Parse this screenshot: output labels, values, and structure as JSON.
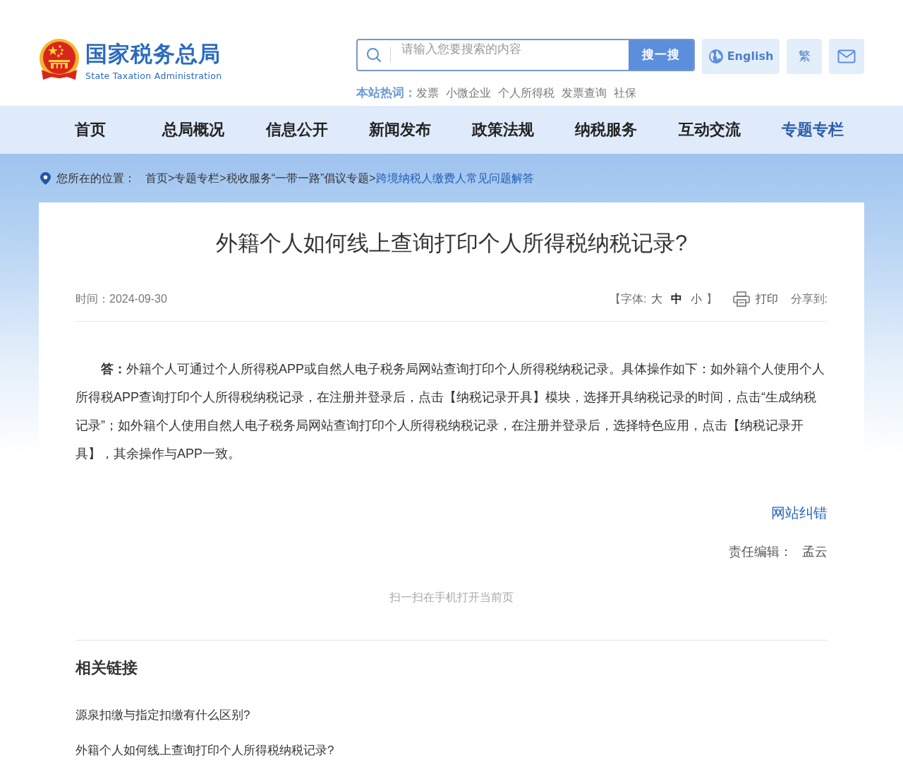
{
  "header": {
    "logo": {
      "title": "国家税务总局",
      "subtitle": "State Taxation Administration"
    },
    "search": {
      "placeholder": "请输入您要搜索的内容",
      "button": "搜一搜"
    },
    "hot_words": {
      "label": "本站热词：",
      "items": [
        "发票",
        "小微企业",
        "个人所得税",
        "发票查询",
        "社保"
      ]
    },
    "language_button": "English",
    "script_button": "繁"
  },
  "nav": [
    {
      "label": "首页",
      "selected": false
    },
    {
      "label": "总局概况",
      "selected": false
    },
    {
      "label": "信息公开",
      "selected": false
    },
    {
      "label": "新闻发布",
      "selected": false
    },
    {
      "label": "政策法规",
      "selected": false
    },
    {
      "label": "纳税服务",
      "selected": false
    },
    {
      "label": "互动交流",
      "selected": false
    },
    {
      "label": "专题专栏",
      "selected": true
    }
  ],
  "breadcrumb": {
    "label": "您所在的位置：",
    "items": [
      {
        "label": "首页",
        "separator": ">",
        "current": false
      },
      {
        "label": "专题专栏",
        "separator": ">",
        "current": false
      },
      {
        "label": "税收服务“一带一路”倡议专题",
        "separator": ">",
        "current": false
      },
      {
        "label": "跨境纳税人缴费人常见问题解答",
        "current": true
      }
    ]
  },
  "article": {
    "title": "外籍个人如何线上查询打印个人所得税纳税记录?",
    "date_label": "时间：",
    "date": "2024-09-30",
    "font_size": {
      "open": "【字体:",
      "options": [
        {
          "label": "大",
          "selected": false
        },
        {
          "label": "中",
          "selected": true
        },
        {
          "label": "小",
          "selected": false
        }
      ],
      "close": "】"
    },
    "print": "打印",
    "share": "分享到:",
    "body": "**答：**外籍个人可通过个人所得税APP或自然人电子税务局网站查询打印个人所得税纳税记录。具体操作如下：如外籍个人使用个人所得税APP查询打印个人所得税纳税记录，在注册并登录后，点击【纳税记录开具】模块，选择开具纳税记录的时间，点击“生成纳税记录”；如外籍个人使用自然人电子税务局网站查询打印个人所得税纳税记录，在注册并登录后，选择特色应用，点击【纳税记录开具】，其余操作与APP一致。",
    "correction_link": "网站纠错",
    "editor_label": "责任编辑：",
    "editor": "孟云",
    "qr_caption": "扫一扫在手机打开当前页"
  },
  "related": {
    "title": "相关链接",
    "links": [
      "源泉扣缴与指定扣缴有什么区别?",
      "外籍个人如何线上查询打印个人所得税纳税记录?"
    ]
  }
}
